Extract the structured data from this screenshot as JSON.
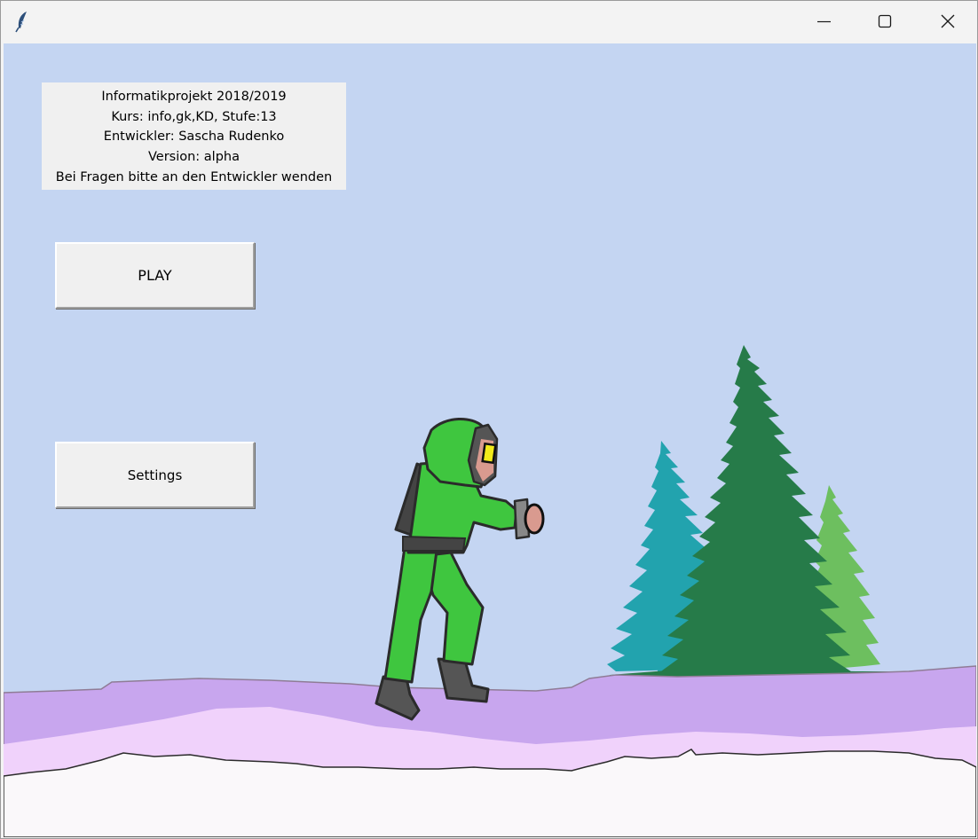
{
  "window": {
    "title": "",
    "controls": {
      "minimize": "minimize-icon",
      "maximize": "maximize-icon",
      "close": "close-icon"
    },
    "app_icon": "feather-icon"
  },
  "info": {
    "lines": [
      "Informatikprojekt 2018/2019",
      "Kurs: info,gk,KD, Stufe:13",
      "Entwickler: Sascha Rudenko",
      "Version: alpha",
      "Bei Fragen bitte an den Entwickler wenden"
    ]
  },
  "menu": {
    "play_label": "PLAY",
    "settings_label": "Settings"
  },
  "colors": {
    "sky": "#c4d5f2",
    "snow": "#faf8fa",
    "hill_purple": "#c8a6ee",
    "hill_light": "#f0d2fb",
    "tree_dark": "#267b49",
    "tree_teal": "#22a3ae",
    "tree_light": "#6dbf5f",
    "suit_green": "#3fc63f"
  }
}
